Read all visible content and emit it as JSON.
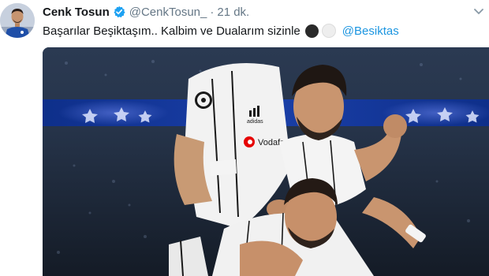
{
  "tweet": {
    "author_name": "Cenk Tosun",
    "handle": "@CenkTosun_",
    "separator": "·",
    "time": "21 dk.",
    "verified": true,
    "text": "Başarılar Beşiktaşım.. Kalbim ve Dualarım sizinle",
    "emojis": [
      "black-circle",
      "white-circle"
    ],
    "mention": "@Besiktas",
    "avatar_icon": "avatar-photo",
    "more_icon": "chevron-down-icon",
    "media": {
      "type": "photo",
      "shirt_sponsor": "Vodafone",
      "shirt_brand": "adidas"
    }
  },
  "colors": {
    "name": "#14171a",
    "secondary": "#657786",
    "link": "#1b95e0",
    "verified": "#1da1f2"
  }
}
